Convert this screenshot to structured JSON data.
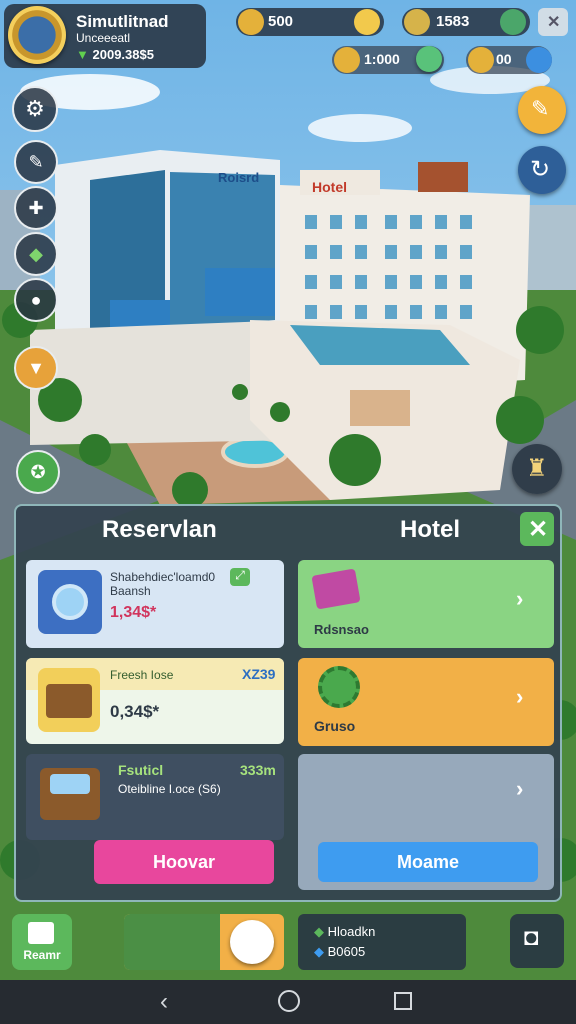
{
  "profile": {
    "name": "Simutlitnad",
    "subtitle": "Unceeeatl",
    "money": "2009.38$5"
  },
  "currencies": {
    "gold": "500",
    "cash": "1583",
    "keys": "1:000",
    "extra": "00"
  },
  "panel": {
    "left_title": "Reservlan",
    "right_title": "Hotel",
    "items": [
      {
        "title": "Shabehdiec'loamd0",
        "subtitle": "Baansh",
        "price": "1,34$*",
        "badge": ""
      },
      {
        "title": "Freesh Iose",
        "subtitle": "",
        "price": "0,34$*",
        "badge": "XZ39"
      },
      {
        "title": "Fsuticl",
        "subtitle": "Oteibline I.oce (S6)",
        "price": "",
        "badge": "333m"
      }
    ],
    "options": [
      {
        "label": "Rdsnsao",
        "color": "#8ad483"
      },
      {
        "label": "Gruso",
        "color": "#f2b047"
      },
      {
        "label": "",
        "color": "#97a9bb"
      }
    ],
    "left_button": "Hoovar",
    "right_button": "Moame"
  },
  "bottom": {
    "reserve_label": "Reamr",
    "stat1": "Hloadkn",
    "stat2": "B0605"
  },
  "colors": {
    "pink": "#e8479d",
    "blue": "#3e9cf0",
    "green": "#5cb85c",
    "orange": "#f2b047"
  }
}
